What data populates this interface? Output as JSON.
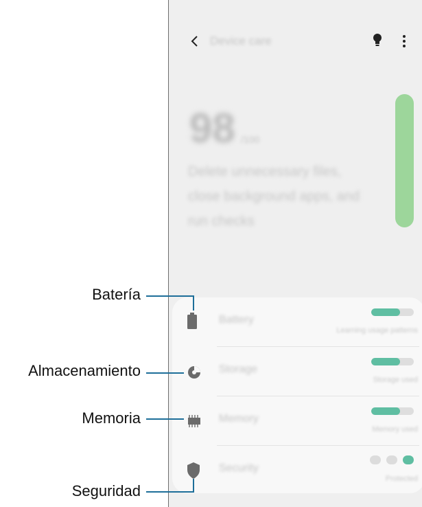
{
  "appbar": {
    "title": "Device care",
    "back_icon": "chevron-left-icon",
    "tips_icon": "lightbulb-icon",
    "more_icon": "more-vertical-icon"
  },
  "summary": {
    "score": "98",
    "score_unit": "/100",
    "description": "Delete unnecessary files, close background apps, and run checks"
  },
  "card": {
    "rows": [
      {
        "title": "Battery",
        "status": "Learning usage patterns",
        "icon": "battery-icon",
        "level": 0.68
      },
      {
        "title": "Storage",
        "status": "Storage used",
        "icon": "pie-chart-icon",
        "level": 0.68
      },
      {
        "title": "Memory",
        "status": "Memory used",
        "icon": "memory-chip-icon",
        "level": 0.68
      },
      {
        "title": "Security",
        "status": "Protected",
        "icon": "shield-icon",
        "security_active_dot": 3
      }
    ]
  },
  "callouts": {
    "battery": "Batería",
    "storage": "Almacenamiento",
    "memory": "Memoria",
    "security": "Seguridad"
  },
  "colors": {
    "accent_green": "#5fbea2",
    "score_bar": "#9dd69b",
    "leader_line": "#1d6e99"
  }
}
